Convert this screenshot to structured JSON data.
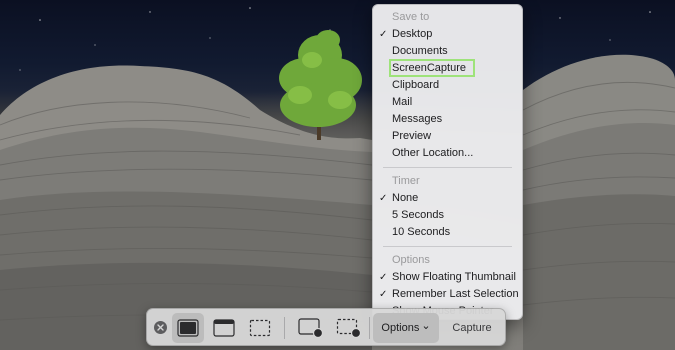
{
  "menu": {
    "save_to": {
      "header": "Save to",
      "items": [
        {
          "label": "Desktop",
          "checked": true
        },
        {
          "label": "Documents",
          "checked": false
        },
        {
          "label": "ScreenCapture",
          "checked": false,
          "highlighted": true
        },
        {
          "label": "Clipboard",
          "checked": false
        },
        {
          "label": "Mail",
          "checked": false
        },
        {
          "label": "Messages",
          "checked": false
        },
        {
          "label": "Preview",
          "checked": false
        },
        {
          "label": "Other Location...",
          "checked": false
        }
      ]
    },
    "timer": {
      "header": "Timer",
      "items": [
        {
          "label": "None",
          "checked": true
        },
        {
          "label": "5 Seconds",
          "checked": false
        },
        {
          "label": "10 Seconds",
          "checked": false
        }
      ]
    },
    "options": {
      "header": "Options",
      "items": [
        {
          "label": "Show Floating Thumbnail",
          "checked": true
        },
        {
          "label": "Remember Last Selection",
          "checked": true
        },
        {
          "label": "Show Mouse Pointer",
          "checked": false
        }
      ]
    },
    "check_glyph": "✓",
    "highlight_color": "#9ee37a"
  },
  "toolbar": {
    "options_label": "Options",
    "options_chevron": "⌄",
    "capture_label": "Capture",
    "icons": [
      "close-icon",
      "capture-entire-screen-icon",
      "capture-window-icon",
      "capture-selection-icon",
      "record-entire-screen-icon",
      "record-selection-icon"
    ]
  }
}
